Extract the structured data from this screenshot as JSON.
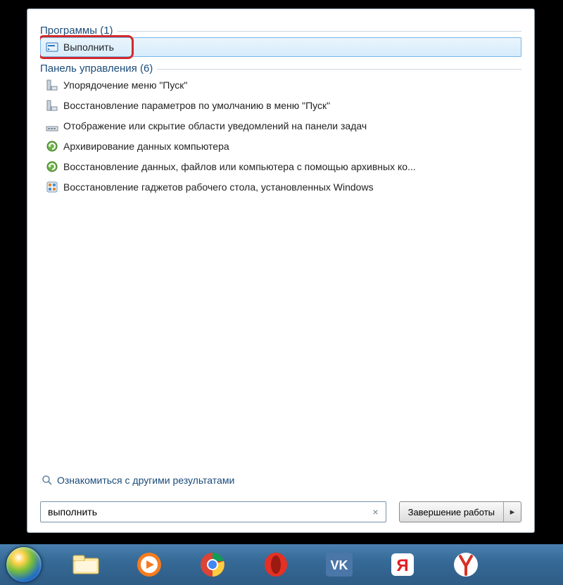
{
  "sections": {
    "programs": {
      "title": "Программы (1)",
      "items": [
        {
          "label": "Выполнить",
          "icon": "run-icon",
          "selected": true,
          "highlighted": true
        }
      ]
    },
    "control_panel": {
      "title": "Панель управления (6)",
      "items": [
        {
          "label": "Упорядочение меню \"Пуск\"",
          "icon": "taskbar-icon"
        },
        {
          "label": "Восстановление параметров по умолчанию в меню \"Пуск\"",
          "icon": "taskbar-icon"
        },
        {
          "label": "Отображение или скрытие области уведомлений на панели задач",
          "icon": "notify-icon"
        },
        {
          "label": "Архивирование данных компьютера",
          "icon": "backup-icon"
        },
        {
          "label": "Восстановление данных, файлов или компьютера с помощью архивных ко...",
          "icon": "backup-icon"
        },
        {
          "label": "Восстановление гаджетов рабочего стола, установленных Windows",
          "icon": "gadget-icon"
        }
      ]
    }
  },
  "more_results": "Ознакомиться с другими результатами",
  "search": {
    "value": "выполнить",
    "clear_symbol": "×"
  },
  "shutdown": {
    "label": "Завершение работы",
    "arrow": "▸"
  },
  "taskbar": [
    {
      "name": "start-button",
      "icon": "start-orb"
    },
    {
      "name": "explorer",
      "icon": "explorer-icon"
    },
    {
      "name": "media-player",
      "icon": "wmp-icon"
    },
    {
      "name": "chrome",
      "icon": "chrome-icon"
    },
    {
      "name": "opera",
      "icon": "opera-icon"
    },
    {
      "name": "vk",
      "icon": "vk-icon"
    },
    {
      "name": "yandex",
      "icon": "yandex-red-icon"
    },
    {
      "name": "yandex-browser",
      "icon": "yandex-y-icon"
    }
  ]
}
